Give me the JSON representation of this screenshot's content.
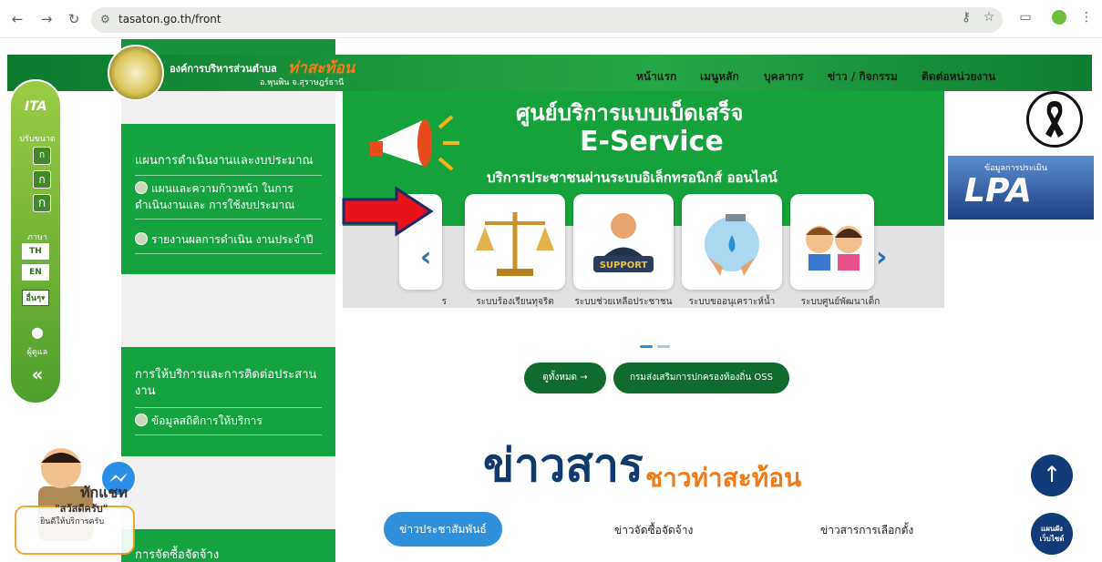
{
  "browser": {
    "url": "tasaton.go.th/front"
  },
  "header": {
    "org_name": "องค์การบริหารส่วนตำบล",
    "org_brand": "ท่าสะท้อน",
    "org_location": "อ.พุนพิน จ.สุราษฎร์ธานี",
    "menu": [
      "หน้าแรก",
      "เมนูหลัก",
      "บุคลากร",
      "ข่าว / กิจกรรม",
      "ติดต่อหน่วยงาน"
    ]
  },
  "ita_bar": {
    "logo": "ITA",
    "font_size_label": "ปรับขนาด",
    "font_buttons": [
      "ก",
      "ก",
      "ก"
    ],
    "language_label": "ภาษา",
    "languages": [
      "TH",
      "EN"
    ],
    "other_button": "อื่นๆ",
    "admin_label": "ผู้ดูแล",
    "collapse_icon": "«"
  },
  "panels": [
    {
      "title": "แผนการดำเนินงานและงบประมาณ",
      "items": [
        "แผนและความก้าวหน้า ในการดำเนินงานและ การใช้งบประมาณ",
        "รายงานผลการดำเนิน งานประจำปี"
      ]
    },
    {
      "title": "การให้บริการและการติดต่อประสานงาน",
      "items": [
        "ข้อมูลสถิติการให้บริการ"
      ]
    },
    {
      "title": "การจัดซื้อจัดจ้าง",
      "items": []
    }
  ],
  "eservice": {
    "title": "ศูนย์บริการแบบเบ็ดเสร็จ",
    "subtitle": "E-Service",
    "description": "บริการประชาชนผ่านระบบอิเล็กทรอนิกส์ ออนไลน์"
  },
  "carousel": {
    "partial_label": "ร",
    "cards": [
      {
        "label": "ระบบร้องเรียนทุจริต",
        "icon": "scales-icon"
      },
      {
        "label": "ระบบช่วยเหลือประชาชน",
        "icon": "support-icon",
        "icon_text": "SUPPORT"
      },
      {
        "label": "ระบบขออนุเคราะห์น้ำ",
        "icon": "water-tap-icon"
      },
      {
        "label": "ระบบศูนย์พัฒนาเด็ก",
        "icon": "children-icon"
      }
    ]
  },
  "buttons": {
    "view_all": "ดูทั้งหมด →",
    "oss": "กรมส่งเสริมการปกครองท้องถิ่น OSS"
  },
  "news": {
    "title": "ข่าวสาร",
    "subtitle": "ชาวท่าสะท้อน",
    "tabs": [
      "ข่าวประชาสัมพันธ์",
      "ข่าวจัดซื้อจัดจ้าง",
      "ข่าวสารการเลือกตั้ง"
    ]
  },
  "widgets": {
    "lpa_caption": "ข้อมูลการประเมิน",
    "lpa_text": "LPA",
    "sitemap": "แผนผังเว็บไซต์",
    "up_icon": "↑"
  },
  "chat": {
    "title": "ทักแชท",
    "greeting": "\"สวัสดีครับ\"",
    "sub": "ยินดีให้บริการครับ"
  },
  "colors": {
    "brand_green": "#14a33f",
    "navy": "#10396e",
    "orange": "#f07a1a",
    "blue": "#2f8fd8"
  }
}
